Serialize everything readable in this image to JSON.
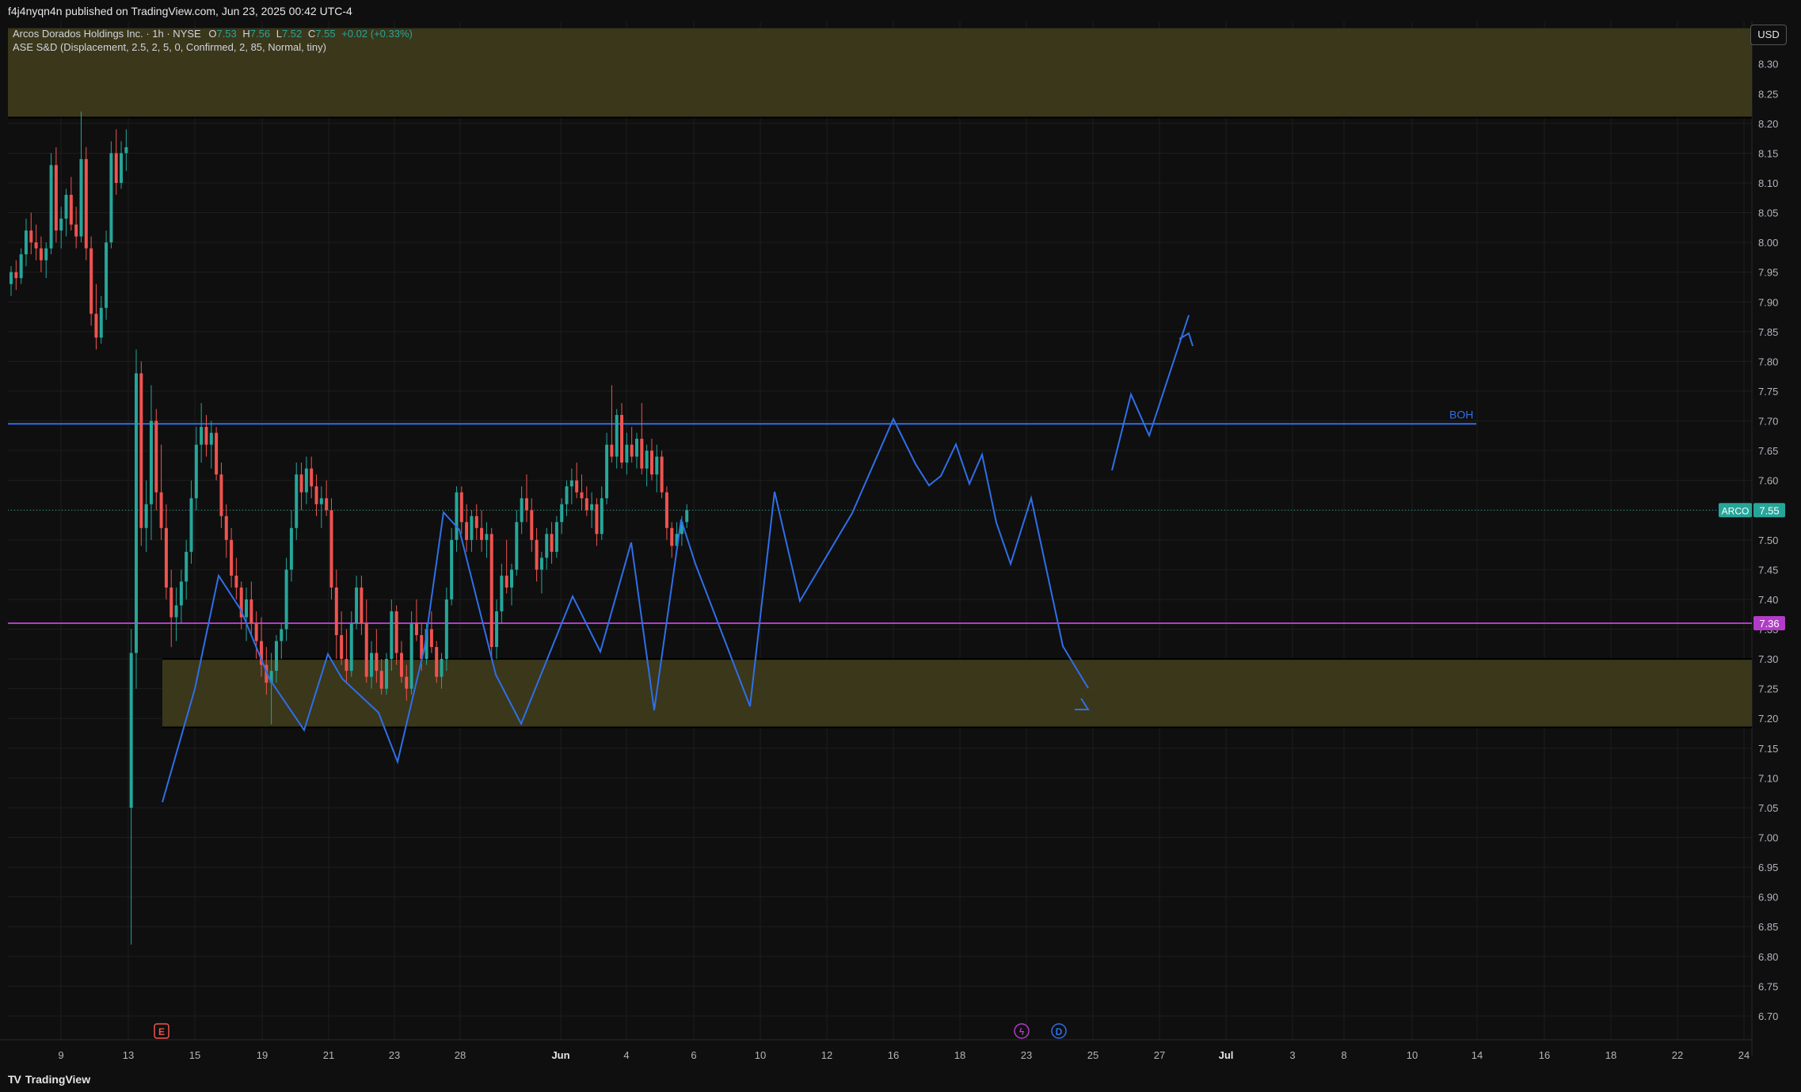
{
  "header": {
    "publisher_line": "f4j4nyqn4n published on TradingView.com, Jun 23, 2025 00:42 UTC-4"
  },
  "legend": {
    "symbol": "Arcos Dorados Holdings Inc. · 1h · NYSE",
    "open_label": "O",
    "open": "7.53",
    "high_label": "H",
    "high": "7.56",
    "low_label": "L",
    "low": "7.52",
    "close_label": "C",
    "close": "7.55",
    "change": "+0.02 (+0.33%)",
    "indicator": "ASE S&D (Displacement, 2.5, 2, 5, 0, Confirmed, 2, 85, Normal, tiny)"
  },
  "currency_button": "USD",
  "footer": {
    "brand": "TradingView"
  },
  "colors": {
    "background": "#0f0f0f",
    "up": "#26a69a",
    "down": "#ef5350",
    "zone": "#3d3a1c",
    "drawing": "#2f6fe8",
    "magenta": "#b13cc7",
    "grid": "#1e1e1e"
  },
  "chart_data": {
    "type": "candlestick",
    "title": "Arcos Dorados Holdings Inc. · 1h · NYSE",
    "ylim": [
      6.66,
      8.36
    ],
    "y_ticks": [
      "6.70",
      "6.75",
      "6.80",
      "6.85",
      "6.90",
      "6.95",
      "7.00",
      "7.05",
      "7.10",
      "7.15",
      "7.20",
      "7.25",
      "7.30",
      "7.35",
      "7.40",
      "7.45",
      "7.50",
      "7.55",
      "7.60",
      "7.65",
      "7.70",
      "7.75",
      "7.80",
      "7.85",
      "7.90",
      "7.95",
      "8.00",
      "8.05",
      "8.10",
      "8.15",
      "8.20",
      "8.25",
      "8.30"
    ],
    "x_ticks": [
      "9",
      "13",
      "15",
      "19",
      "21",
      "23",
      "28",
      "Jun",
      "4",
      "6",
      "10",
      "12",
      "16",
      "18",
      "23",
      "25",
      "27",
      "Jul",
      "3",
      "8",
      "10",
      "14",
      "16",
      "18",
      "22",
      "24"
    ],
    "grid": true,
    "last_price": {
      "label": "ARCO",
      "value": "7.55"
    },
    "level_line": {
      "value": "7.36"
    },
    "boh_line": {
      "label": "BOH",
      "value": 7.695
    },
    "supply_zone": {
      "top": 8.36,
      "bottom": 8.21
    },
    "demand_zone": {
      "top": 7.3,
      "bottom": 7.185
    },
    "event_markers": [
      {
        "icon": "earnings-icon",
        "glyph": "E",
        "x_label": "14"
      },
      {
        "icon": "split-icon",
        "glyph": "ϟ",
        "x_label": "22"
      },
      {
        "icon": "dividend-icon",
        "glyph": "D",
        "x_label": "23"
      }
    ],
    "candles": [
      [
        7.93,
        7.96,
        7.91,
        7.95
      ],
      [
        7.95,
        7.97,
        7.92,
        7.94
      ],
      [
        7.94,
        7.99,
        7.93,
        7.98
      ],
      [
        7.98,
        8.04,
        7.96,
        8.02
      ],
      [
        8.02,
        8.05,
        7.98,
        8.0
      ],
      [
        8.0,
        8.03,
        7.97,
        7.99
      ],
      [
        7.99,
        8.01,
        7.95,
        7.97
      ],
      [
        7.97,
        8.0,
        7.94,
        7.99
      ],
      [
        7.99,
        8.15,
        7.98,
        8.13
      ],
      [
        8.13,
        8.16,
        8.0,
        8.02
      ],
      [
        8.02,
        8.06,
        7.99,
        8.04
      ],
      [
        8.04,
        8.09,
        8.01,
        8.08
      ],
      [
        8.08,
        8.11,
        8.02,
        8.03
      ],
      [
        8.03,
        8.06,
        7.99,
        8.01
      ],
      [
        8.01,
        8.22,
        8.0,
        8.14
      ],
      [
        8.14,
        8.16,
        7.97,
        7.99
      ],
      [
        7.99,
        8.01,
        7.86,
        7.88
      ],
      [
        7.88,
        7.93,
        7.82,
        7.84
      ],
      [
        7.84,
        7.91,
        7.83,
        7.89
      ],
      [
        7.89,
        8.02,
        7.87,
        8.0
      ],
      [
        8.0,
        8.17,
        7.99,
        8.15
      ],
      [
        8.15,
        8.19,
        8.08,
        8.1
      ],
      [
        8.1,
        8.17,
        8.09,
        8.15
      ],
      [
        8.15,
        8.19,
        8.12,
        8.16
      ],
      [
        7.05,
        7.35,
        6.82,
        7.31
      ],
      [
        7.31,
        7.82,
        7.25,
        7.78
      ],
      [
        7.78,
        7.8,
        7.49,
        7.52
      ],
      [
        7.52,
        7.6,
        7.48,
        7.56
      ],
      [
        7.56,
        7.76,
        7.5,
        7.7
      ],
      [
        7.7,
        7.72,
        7.55,
        7.58
      ],
      [
        7.58,
        7.66,
        7.5,
        7.52
      ],
      [
        7.52,
        7.56,
        7.4,
        7.42
      ],
      [
        7.42,
        7.45,
        7.32,
        7.37
      ],
      [
        7.37,
        7.42,
        7.33,
        7.39
      ],
      [
        7.39,
        7.45,
        7.36,
        7.43
      ],
      [
        7.43,
        7.5,
        7.4,
        7.48
      ],
      [
        7.48,
        7.6,
        7.46,
        7.57
      ],
      [
        7.57,
        7.69,
        7.55,
        7.66
      ],
      [
        7.66,
        7.73,
        7.63,
        7.69
      ],
      [
        7.69,
        7.71,
        7.64,
        7.66
      ],
      [
        7.66,
        7.7,
        7.62,
        7.68
      ],
      [
        7.68,
        7.69,
        7.6,
        7.61
      ],
      [
        7.61,
        7.63,
        7.52,
        7.54
      ],
      [
        7.54,
        7.56,
        7.47,
        7.5
      ],
      [
        7.5,
        7.52,
        7.42,
        7.44
      ],
      [
        7.44,
        7.47,
        7.4,
        7.42
      ],
      [
        7.42,
        7.43,
        7.35,
        7.37
      ],
      [
        7.37,
        7.42,
        7.33,
        7.4
      ],
      [
        7.4,
        7.43,
        7.34,
        7.36
      ],
      [
        7.36,
        7.38,
        7.3,
        7.33
      ],
      [
        7.33,
        7.37,
        7.27,
        7.29
      ],
      [
        7.29,
        7.32,
        7.24,
        7.26
      ],
      [
        7.26,
        7.31,
        7.19,
        7.28
      ],
      [
        7.28,
        7.34,
        7.26,
        7.33
      ],
      [
        7.33,
        7.36,
        7.3,
        7.35
      ],
      [
        7.35,
        7.47,
        7.33,
        7.45
      ],
      [
        7.45,
        7.55,
        7.43,
        7.52
      ],
      [
        7.52,
        7.63,
        7.5,
        7.61
      ],
      [
        7.61,
        7.63,
        7.55,
        7.58
      ],
      [
        7.58,
        7.64,
        7.56,
        7.62
      ],
      [
        7.62,
        7.64,
        7.57,
        7.59
      ],
      [
        7.59,
        7.61,
        7.54,
        7.56
      ],
      [
        7.56,
        7.59,
        7.52,
        7.57
      ],
      [
        7.57,
        7.6,
        7.54,
        7.55
      ],
      [
        7.55,
        7.57,
        7.4,
        7.42
      ],
      [
        7.42,
        7.45,
        7.3,
        7.34
      ],
      [
        7.34,
        7.38,
        7.29,
        7.3
      ],
      [
        7.3,
        7.35,
        7.26,
        7.28
      ],
      [
        7.28,
        7.38,
        7.27,
        7.36
      ],
      [
        7.36,
        7.44,
        7.35,
        7.42
      ],
      [
        7.42,
        7.44,
        7.34,
        7.36
      ],
      [
        7.36,
        7.4,
        7.26,
        7.27
      ],
      [
        7.27,
        7.33,
        7.25,
        7.31
      ],
      [
        7.31,
        7.35,
        7.26,
        7.28
      ],
      [
        7.28,
        7.3,
        7.24,
        7.25
      ],
      [
        7.25,
        7.31,
        7.24,
        7.3
      ],
      [
        7.3,
        7.4,
        7.28,
        7.38
      ],
      [
        7.38,
        7.39,
        7.29,
        7.31
      ],
      [
        7.31,
        7.33,
        7.26,
        7.27
      ],
      [
        7.27,
        7.29,
        7.23,
        7.25
      ],
      [
        7.25,
        7.38,
        7.24,
        7.36
      ],
      [
        7.36,
        7.4,
        7.33,
        7.34
      ],
      [
        7.34,
        7.36,
        7.28,
        7.3
      ],
      [
        7.3,
        7.36,
        7.29,
        7.35
      ],
      [
        7.35,
        7.38,
        7.31,
        7.32
      ],
      [
        7.32,
        7.33,
        7.26,
        7.27
      ],
      [
        7.27,
        7.31,
        7.25,
        7.3
      ],
      [
        7.3,
        7.42,
        7.28,
        7.4
      ],
      [
        7.4,
        7.52,
        7.39,
        7.5
      ],
      [
        7.5,
        7.59,
        7.48,
        7.58
      ],
      [
        7.58,
        7.59,
        7.51,
        7.53
      ],
      [
        7.53,
        7.56,
        7.48,
        7.5
      ],
      [
        7.5,
        7.55,
        7.48,
        7.54
      ],
      [
        7.54,
        7.56,
        7.5,
        7.52
      ],
      [
        7.52,
        7.55,
        7.48,
        7.5
      ],
      [
        7.5,
        7.53,
        7.47,
        7.51
      ],
      [
        7.51,
        7.52,
        7.3,
        7.32
      ],
      [
        7.32,
        7.4,
        7.3,
        7.38
      ],
      [
        7.38,
        7.46,
        7.36,
        7.44
      ],
      [
        7.44,
        7.5,
        7.41,
        7.42
      ],
      [
        7.42,
        7.46,
        7.39,
        7.45
      ],
      [
        7.45,
        7.55,
        7.44,
        7.53
      ],
      [
        7.53,
        7.59,
        7.51,
        7.57
      ],
      [
        7.57,
        7.61,
        7.53,
        7.55
      ],
      [
        7.55,
        7.57,
        7.48,
        7.5
      ],
      [
        7.5,
        7.52,
        7.43,
        7.45
      ],
      [
        7.45,
        7.48,
        7.41,
        7.47
      ],
      [
        7.47,
        7.52,
        7.45,
        7.51
      ],
      [
        7.51,
        7.53,
        7.46,
        7.48
      ],
      [
        7.48,
        7.54,
        7.47,
        7.53
      ],
      [
        7.53,
        7.57,
        7.51,
        7.56
      ],
      [
        7.56,
        7.6,
        7.54,
        7.59
      ],
      [
        7.59,
        7.62,
        7.56,
        7.6
      ],
      [
        7.6,
        7.63,
        7.57,
        7.58
      ],
      [
        7.58,
        7.61,
        7.55,
        7.57
      ],
      [
        7.57,
        7.59,
        7.54,
        7.55
      ],
      [
        7.55,
        7.58,
        7.52,
        7.56
      ],
      [
        7.56,
        7.57,
        7.49,
        7.51
      ],
      [
        7.51,
        7.59,
        7.5,
        7.57
      ],
      [
        7.57,
        7.68,
        7.56,
        7.66
      ],
      [
        7.66,
        7.76,
        7.63,
        7.64
      ],
      [
        7.64,
        7.72,
        7.62,
        7.71
      ],
      [
        7.71,
        7.73,
        7.62,
        7.63
      ],
      [
        7.63,
        7.68,
        7.61,
        7.66
      ],
      [
        7.66,
        7.69,
        7.63,
        7.64
      ],
      [
        7.64,
        7.68,
        7.62,
        7.67
      ],
      [
        7.67,
        7.73,
        7.61,
        7.62
      ],
      [
        7.62,
        7.66,
        7.59,
        7.65
      ],
      [
        7.65,
        7.67,
        7.6,
        7.61
      ],
      [
        7.61,
        7.66,
        7.58,
        7.64
      ],
      [
        7.64,
        7.65,
        7.57,
        7.58
      ],
      [
        7.58,
        7.59,
        7.5,
        7.52
      ],
      [
        7.52,
        7.53,
        7.47,
        7.49
      ],
      [
        7.49,
        7.53,
        7.48,
        7.51
      ],
      [
        7.51,
        7.54,
        7.49,
        7.53
      ],
      [
        7.53,
        7.56,
        7.52,
        7.55
      ]
    ]
  }
}
